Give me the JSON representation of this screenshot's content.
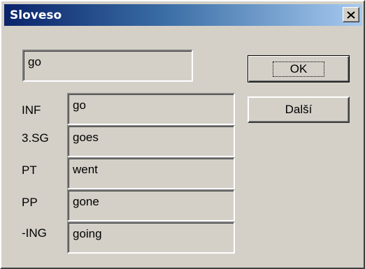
{
  "window": {
    "title": "Sloveso",
    "close_icon": "close-x-icon"
  },
  "input": {
    "value": "go"
  },
  "buttons": {
    "ok_label": "OK",
    "next_label": "Další"
  },
  "forms": [
    {
      "label": "INF",
      "value": "go"
    },
    {
      "label": "3.SG",
      "value": "goes"
    },
    {
      "label": "PT",
      "value": "went"
    },
    {
      "label": "PP",
      "value": "gone"
    },
    {
      "label": "-ING",
      "value": "going"
    }
  ],
  "colors": {
    "dialog_bg": "#d4d0c8",
    "title_start": "#0a246a",
    "title_end": "#a6caf0"
  }
}
